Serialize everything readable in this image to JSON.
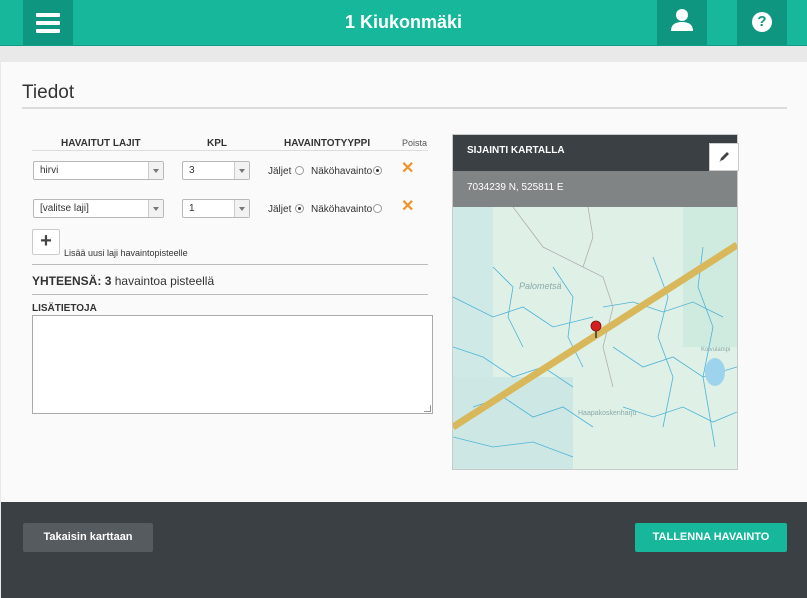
{
  "header": {
    "title": "1 Kiukonmäki",
    "menu_icon": "hamburger-menu-icon",
    "user_icon": "user-icon",
    "help_icon": "question-mark-icon",
    "help_glyph": "?"
  },
  "details": {
    "title": "Tiedot",
    "columns": {
      "species": "HAVAITUT LAJIT",
      "count": "KPL",
      "type": "HAVAINTOTYYPPI",
      "delete": "Poista"
    },
    "rows": [
      {
        "species": "hirvi",
        "count": "3",
        "tracks_label": "Jäljet",
        "sighting_label": "Näköhavainto",
        "selected": "Näköhavainto",
        "delete_glyph": "✕"
      },
      {
        "species": "[valitse laji]",
        "count": "1",
        "tracks_label": "Jäljet",
        "sighting_label": "Näköhavainto",
        "selected": "Jäljet",
        "delete_glyph": "✕"
      }
    ],
    "add_glyph": "+",
    "add_label": "Lisää uusi laji havaintopisteelle",
    "total_prefix": "YHTEENSÄ:",
    "total_count": "3",
    "total_suffix": "havaintoa pisteellä",
    "notes_label": "LISÄTIETOJA",
    "notes_value": ""
  },
  "map": {
    "title": "SIJAINTI KARTALLA",
    "coordinates": "7034239 N, 525811 E",
    "edit_icon": "pencil-icon",
    "marker_icon": "map-pin-icon",
    "place_labels": [
      "Palometsä",
      "Haapakoskenharju",
      "Koivulampi"
    ]
  },
  "footer": {
    "back_label": "Takaisin karttaan",
    "save_label": "TALLENNA HAVAINTO"
  },
  "colors": {
    "accent": "#16b79a",
    "accent_dark": "#0e9680",
    "footer": "#3a4044",
    "delete": "#f0932b"
  }
}
